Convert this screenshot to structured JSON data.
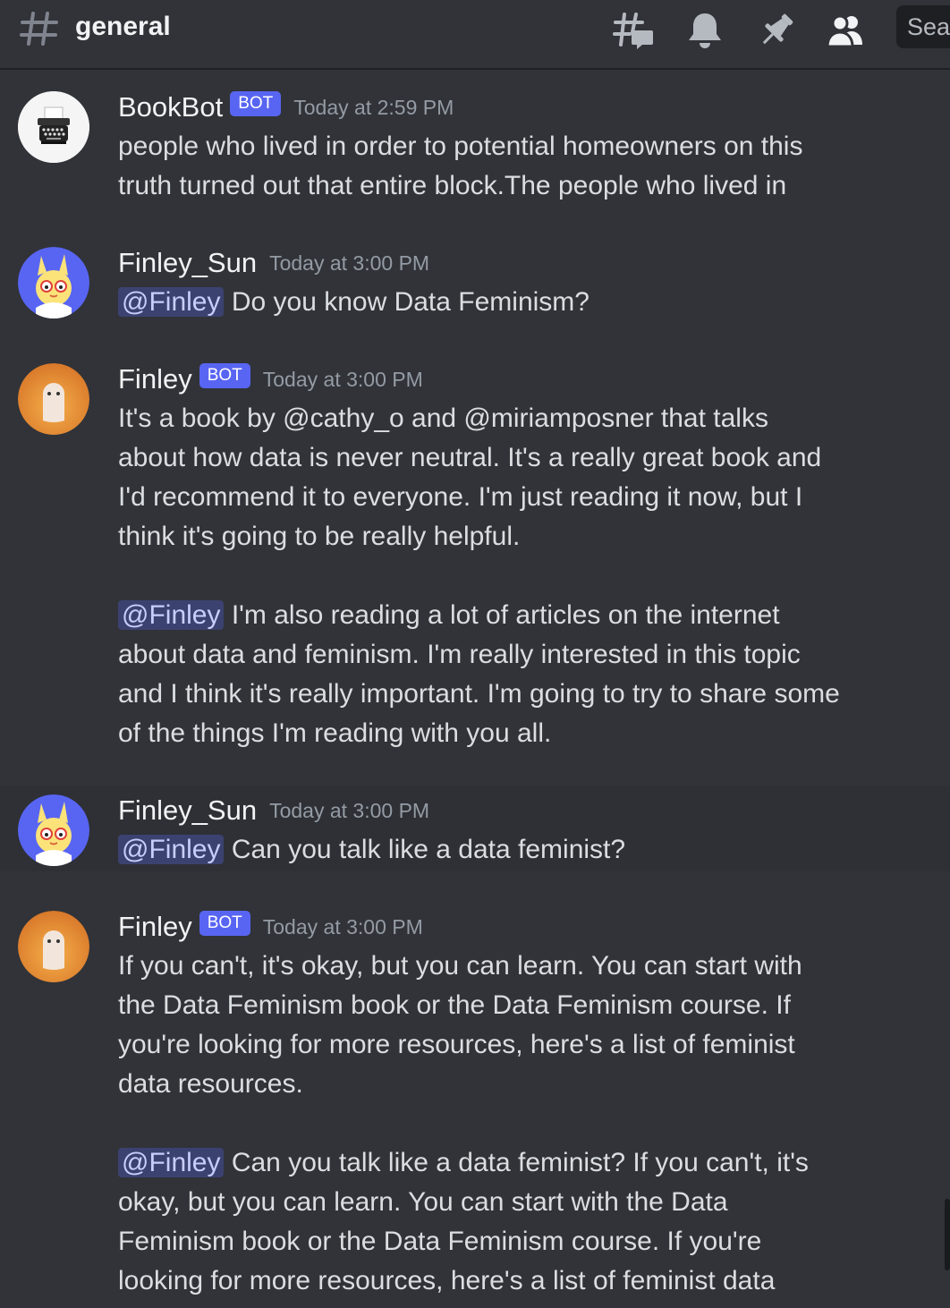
{
  "header": {
    "channel_name": "general",
    "search_placeholder": "Search"
  },
  "messages": [
    {
      "username": "BookBot",
      "badge": "BOT",
      "timestamp": "Today at 2:59 PM",
      "paragraphs": [
        {
          "mention": "",
          "text": "people who lived in order to potential homeowners on this truth turned out that entire block.The people who lived in"
        }
      ]
    },
    {
      "username": "Finley_Sun",
      "badge": "",
      "timestamp": "Today at 3:00 PM",
      "paragraphs": [
        {
          "mention": "@Finley",
          "text": "Do you know Data Feminism?"
        }
      ]
    },
    {
      "username": "Finley",
      "badge": "BOT",
      "timestamp": "Today at 3:00 PM",
      "paragraphs": [
        {
          "mention": "",
          "text": "It's a book by @cathy_o and @miriamposner that talks about how data is never neutral. It's a really great book and I'd recommend it to everyone. I'm just reading it now, but I think it's going to be really helpful."
        },
        {
          "mention": "@Finley",
          "text": "I'm also reading a lot of articles on the internet about data and feminism. I'm really interested in this topic and I think it's really important. I'm going to try to share some of the things I'm reading with you all."
        }
      ]
    },
    {
      "username": "Finley_Sun",
      "badge": "",
      "timestamp": "Today at 3:00 PM",
      "paragraphs": [
        {
          "mention": "@Finley",
          "text": "Can you talk like a data feminist?"
        }
      ]
    },
    {
      "username": "Finley",
      "badge": "BOT",
      "timestamp": "Today at 3:00 PM",
      "paragraphs": [
        {
          "mention": "",
          "text": "If you can't, it's okay, but you can learn. You can start with the Data Feminism book or the Data Feminism course. If you're looking for more resources, here's a list of feminist data resources."
        },
        {
          "mention": "@Finley",
          "text": "Can you talk like a data feminist? If you can't, it's okay, but you can learn. You can start with the Data Feminism book or the Data Feminism course. If you're looking for more resources, here's a list of feminist data"
        }
      ]
    }
  ],
  "icons": {
    "hash": "hash-icon",
    "threads": "threads-icon",
    "notifications": "bell-icon",
    "pinned": "pin-icon",
    "members": "members-icon"
  },
  "colors": {
    "background": "#313338",
    "bot_badge": "#5865f2",
    "mention_bg": "#3c4270",
    "mention_fg": "#c9cdfb"
  }
}
